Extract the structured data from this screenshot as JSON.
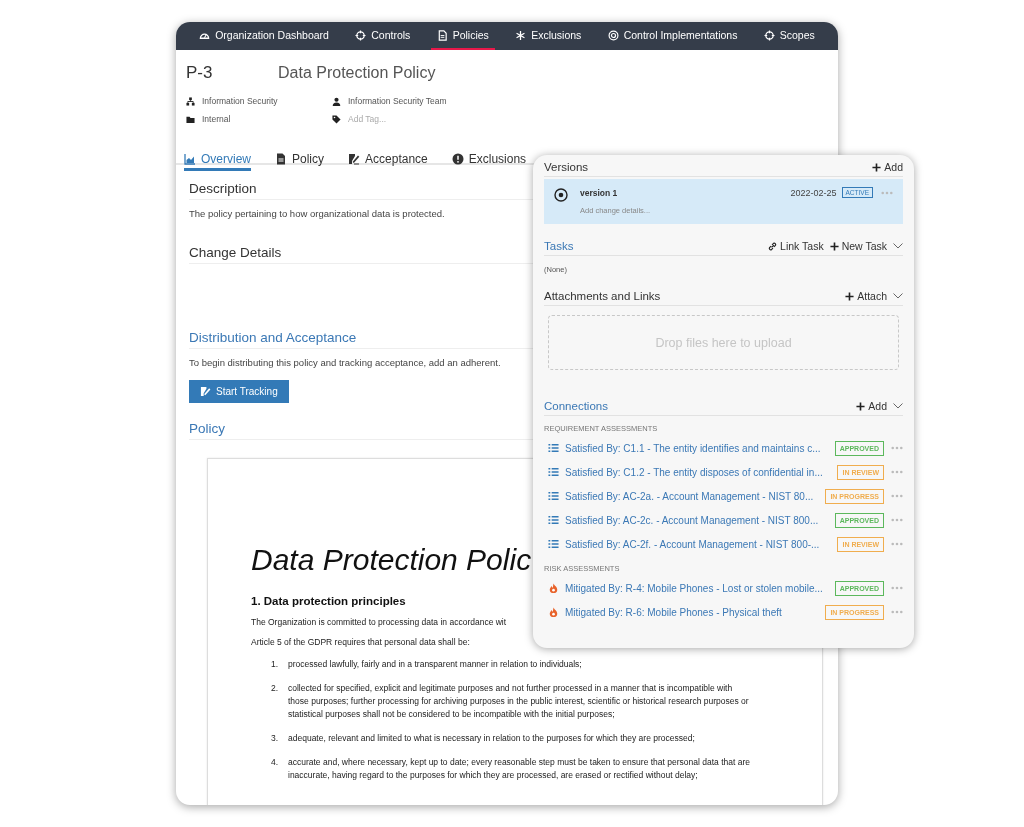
{
  "nav": [
    {
      "label": "Organization Dashboard",
      "selected": false
    },
    {
      "label": "Controls",
      "selected": false
    },
    {
      "label": "Policies",
      "selected": true
    },
    {
      "label": "Exclusions",
      "selected": false
    },
    {
      "label": "Control Implementations",
      "selected": false
    },
    {
      "label": "Scopes",
      "selected": false
    }
  ],
  "policy": {
    "id": "P-3",
    "title": "Data Protection Policy",
    "meta": [
      {
        "text": "Information Security"
      },
      {
        "text": "Information Security Team"
      },
      {
        "text": "Internal"
      },
      {
        "placeholder": "Add Tag..."
      }
    ]
  },
  "tabs": [
    {
      "label": "Overview",
      "selected": true
    },
    {
      "label": "Policy",
      "selected": false
    },
    {
      "label": "Acceptance",
      "selected": false
    },
    {
      "label": "Exclusions",
      "selected": false
    }
  ],
  "overview": {
    "description_heading": "Description",
    "description": "The policy pertaining to how organizational data is protected.",
    "change_heading": "Change Details",
    "distribution_heading": "Distribution and Acceptance",
    "distribution_text": "To begin distributing this policy and tracking acceptance, add an adherent.",
    "start_button": "Start Tracking",
    "policy_heading": "Policy"
  },
  "document": {
    "title": "Data Protection Polic",
    "section": "1. Data protection principles",
    "paragraphs": [
      "The Organization is committed to processing data in accordance wit",
      "Article 5 of the GDPR requires that personal data shall be:"
    ],
    "items": [
      {
        "number": "1.",
        "text": "processed lawfully, fairly and in a transparent manner in relation to individuals;"
      },
      {
        "number": "2.",
        "text": "collected for specified, explicit and legitimate purposes and not further processed in a manner that is incompatible with those purposes; further processing for archiving purposes in the public interest, scientific or historical research purposes or statistical purposes shall not be considered to be incompatible with the initial purposes;"
      },
      {
        "number": "3.",
        "text": "adequate, relevant and limited to what is necessary in relation to the purposes for which they are processed;"
      },
      {
        "number": "4.",
        "text": "accurate and, where necessary, kept up to date; every reasonable step must be taken to ensure that personal data that are inaccurate, having regard to the purposes for which they are processed, are erased or rectified without delay;"
      }
    ]
  },
  "panel": {
    "versions": {
      "heading": "Versions",
      "add": "Add",
      "items": [
        {
          "name": "version 1",
          "date": "2022-02-25",
          "status": "ACTIVE",
          "details_placeholder": "Add change details...",
          "selected": true
        }
      ]
    },
    "tasks": {
      "heading": "Tasks",
      "link": "Link Task",
      "new": "New Task",
      "empty": "(None)"
    },
    "attachments": {
      "heading": "Attachments and Links",
      "attach": "Attach",
      "dropzone": "Drop files here to upload"
    },
    "connections": {
      "heading": "Connections",
      "add": "Add",
      "groups": [
        {
          "label": "REQUIREMENT ASSESSMENTS",
          "kind": "requirement",
          "items": [
            {
              "text": "Satisfied By: C1.1 - The entity identifies and maintains c...",
              "status": "APPROVED",
              "color": "#5cb85c"
            },
            {
              "text": "Satisfied By: C1.2 - The entity disposes of confidential in...",
              "status": "IN REVIEW",
              "color": "#f0ad4e"
            },
            {
              "text": "Satisfied By: AC-2a. - Account Management - NIST 80...",
              "status": "IN PROGRESS",
              "color": "#f0ad4e"
            },
            {
              "text": "Satisfied By: AC-2c. - Account Management - NIST 800...",
              "status": "APPROVED",
              "color": "#5cb85c"
            },
            {
              "text": "Satisfied By: AC-2f. - Account Management - NIST 800-...",
              "status": "IN REVIEW",
              "color": "#f0ad4e"
            }
          ]
        },
        {
          "label": "RISK ASSESSMENTS",
          "kind": "risk",
          "items": [
            {
              "text": "Mitigated By: R-4: Mobile Phones - Lost or stolen mobile...",
              "status": "APPROVED",
              "color": "#5cb85c"
            },
            {
              "text": "Mitigated By: R-6: Mobile Phones - Physical theft",
              "status": "IN PROGRESS",
              "color": "#f0ad4e"
            }
          ]
        }
      ]
    }
  }
}
